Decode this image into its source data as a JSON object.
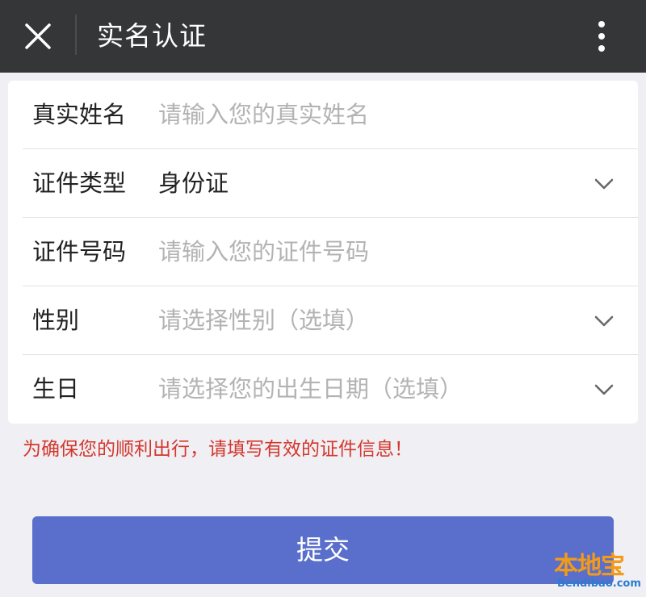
{
  "header": {
    "title": "实名认证",
    "close_icon": "close-icon",
    "more_icon": "more-vertical-icon"
  },
  "form": {
    "fields": [
      {
        "label": "真实姓名",
        "value": "",
        "placeholder": "请输入您的真实姓名",
        "type": "text"
      },
      {
        "label": "证件类型",
        "value": "身份证",
        "placeholder": "",
        "type": "select",
        "icon": "chevron-down-icon"
      },
      {
        "label": "证件号码",
        "value": "",
        "placeholder": "请输入您的证件号码",
        "type": "text"
      },
      {
        "label": "性别",
        "value": "",
        "placeholder": "请选择性别（选填）",
        "type": "select",
        "icon": "chevron-down-icon"
      },
      {
        "label": "生日",
        "value": "",
        "placeholder": "请选择您的出生日期（选填）",
        "type": "select",
        "icon": "chevron-down-icon"
      }
    ]
  },
  "notice": "为确保您的顺利出行，请填写有效的证件信息！",
  "submit_label": "提交",
  "watermark": {
    "brand": "本地宝",
    "url": "Bendibao.com"
  },
  "colors": {
    "header_bg": "#353637",
    "page_bg": "#efeff4",
    "notice": "#d4372c",
    "button": "#5a6fcb"
  }
}
